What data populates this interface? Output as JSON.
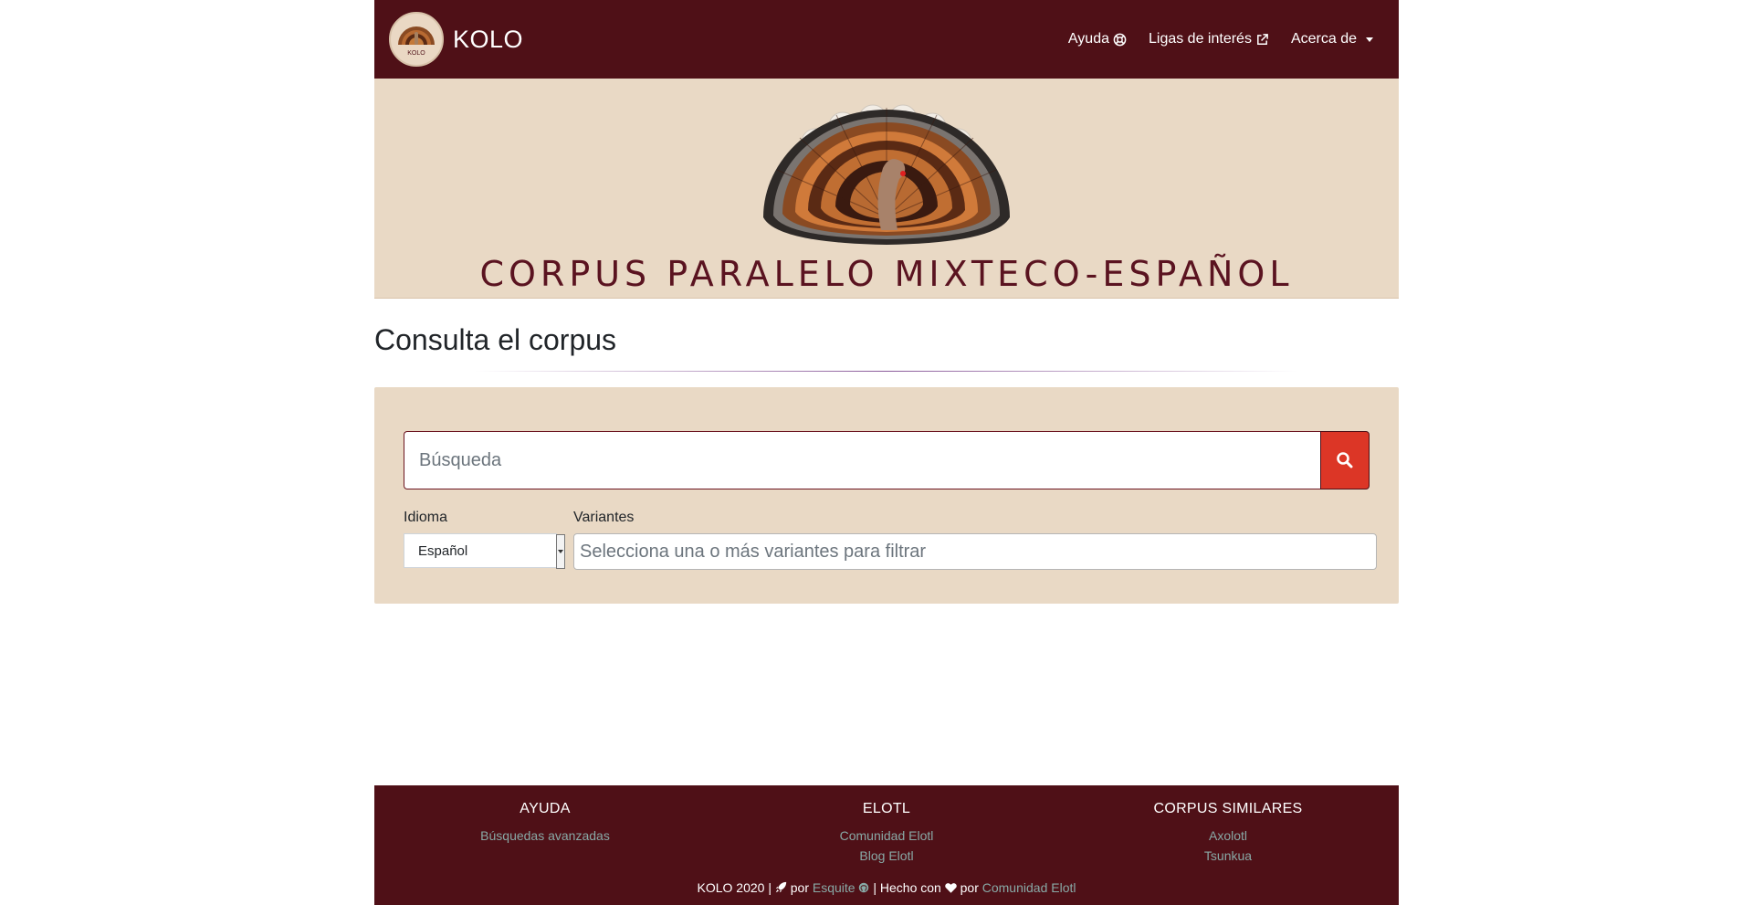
{
  "colors": {
    "navbar": "#4f1017",
    "banner": "#e9d9c5",
    "accent_button": "#dc3626",
    "footer_link": "#88a9a6"
  },
  "navbar": {
    "brand": "KOLO",
    "logo_text": "KOLO",
    "links": [
      {
        "label": "Ayuda",
        "icon": "life-ring-icon"
      },
      {
        "label": "Ligas de interés",
        "icon": "external-link-icon"
      },
      {
        "label": "Acerca de",
        "icon": "caret-down-icon"
      }
    ]
  },
  "banner": {
    "title": "CORPUS PARALELO MIXTECO-ESPAÑOL"
  },
  "main": {
    "title": "Consulta el corpus",
    "search": {
      "placeholder": "Búsqueda",
      "button_icon": "search-icon"
    },
    "language": {
      "label": "Idioma",
      "selected": "Español"
    },
    "variants": {
      "label": "Variantes",
      "placeholder": "Selecciona una o más variantes para filtrar"
    }
  },
  "footer": {
    "columns": [
      {
        "title": "AYUDA",
        "links": [
          "Búsquedas avanzadas"
        ]
      },
      {
        "title": "ELOTL",
        "links": [
          "Comunidad Elotl",
          "Blog Elotl"
        ]
      },
      {
        "title": "CORPUS SIMILARES",
        "links": [
          "Axolotl",
          "Tsunkua"
        ]
      }
    ],
    "credits": {
      "prefix": "KOLO 2020 |",
      "por1": "por",
      "esquite": "Esquite",
      "middle": "| Hecho con",
      "por2": "por",
      "comunidad": "Comunidad Elotl"
    }
  }
}
